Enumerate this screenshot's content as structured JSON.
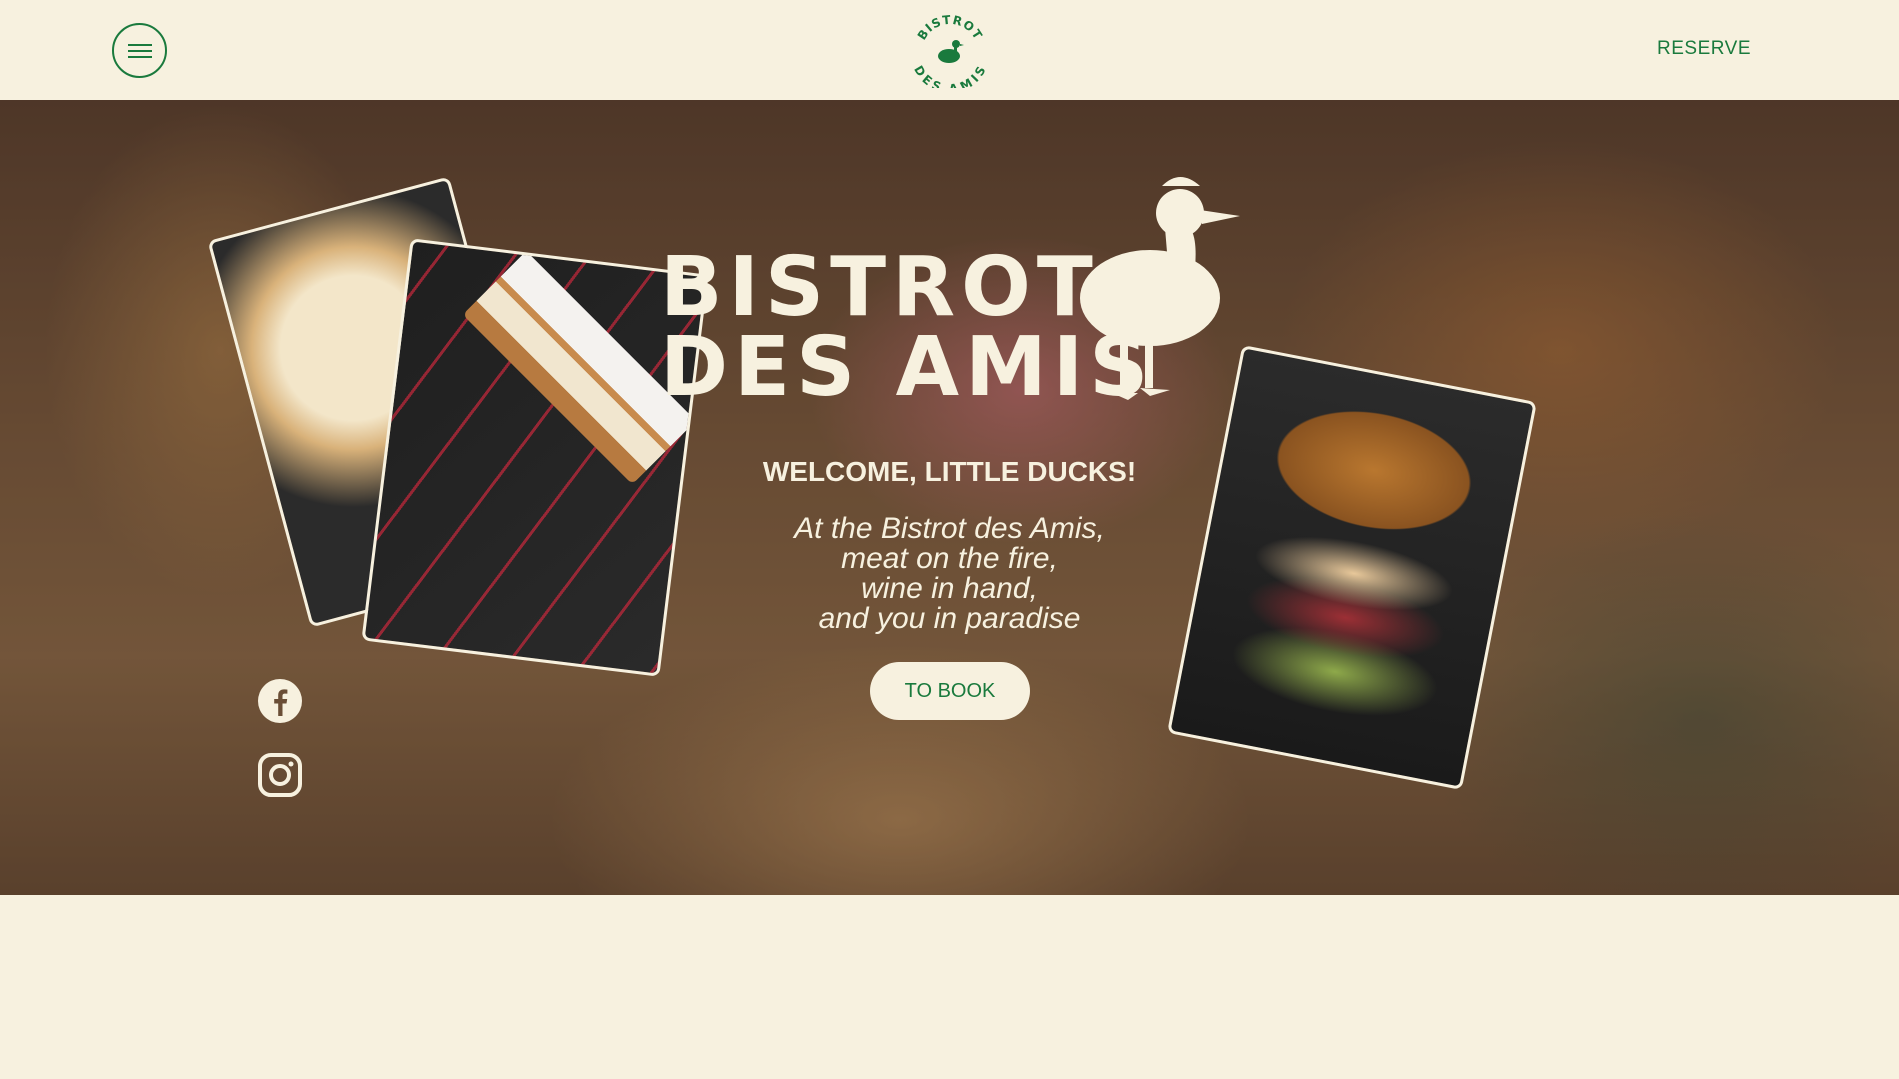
{
  "header": {
    "menu_icon": "hamburger-icon",
    "logo_text_top": "BISTROT",
    "logo_text_bottom": "DES AMIS",
    "reserve_label": "RESERVE"
  },
  "hero": {
    "brand_line1": "BISTROT",
    "brand_line2": "DES AMIS",
    "welcome": "WELCOME, LITTLE DUCKS!",
    "tagline": [
      "At the Bistrot des Amis,",
      "meat on the fire,",
      "wine in hand,",
      "and you in paradise"
    ],
    "book_label": "TO BOOK",
    "social": [
      {
        "name": "facebook-icon"
      },
      {
        "name": "instagram-icon"
      }
    ]
  },
  "colors": {
    "cream": "#f7f1df",
    "green": "#1a7a3d"
  }
}
